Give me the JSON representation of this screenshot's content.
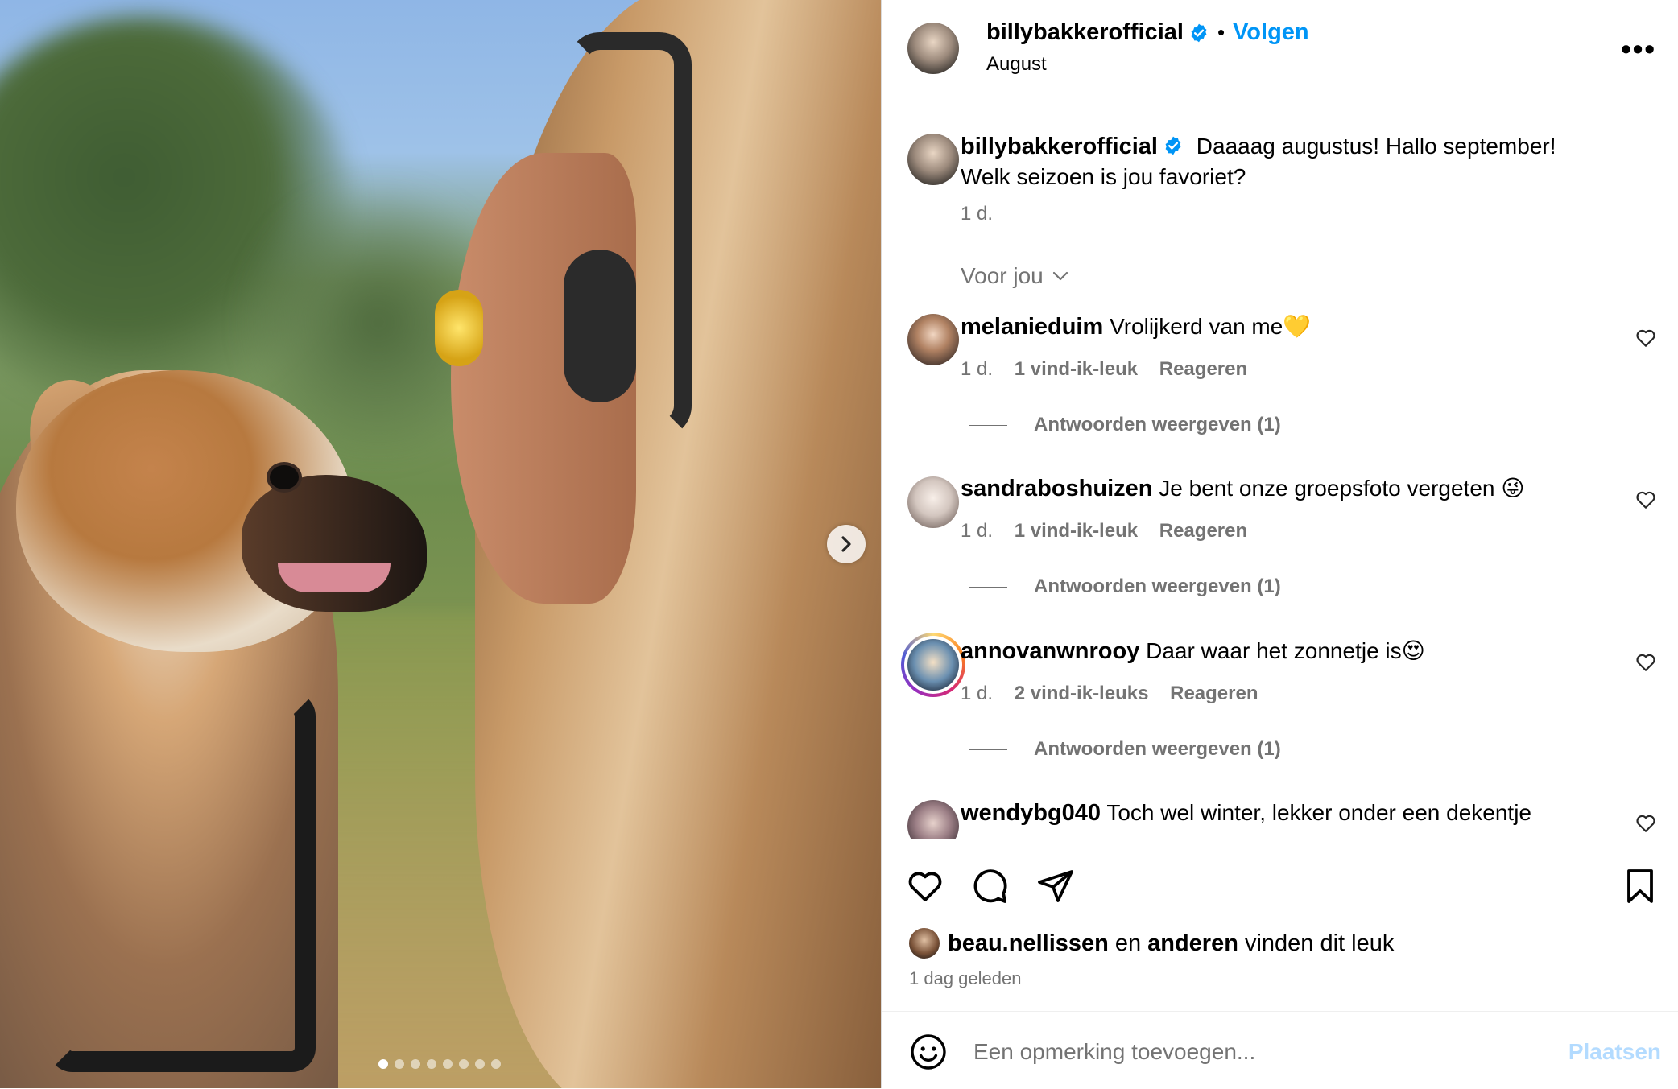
{
  "header": {
    "username": "billybakkerofficial",
    "separator": "•",
    "follow_label": "Volgen",
    "subline": "August",
    "more_label": "•••"
  },
  "caption": {
    "username": "billybakkerofficial",
    "text": "Daaaag augustus! Hallo september!",
    "text_line2": "Welk seizoen is jou favoriet?",
    "time": "1 d."
  },
  "sort": {
    "label": "Voor jou"
  },
  "comments": [
    {
      "username": "melanieduim",
      "text": "Vrolijkerd van me💛",
      "time": "1 d.",
      "likes": "1 vind-ik-leuk",
      "reply": "Reageren",
      "view_replies": "Antwoorden weergeven (1)"
    },
    {
      "username": "sandraboshuizen",
      "text": "Je bent onze groepsfoto vergeten 😜",
      "time": "1 d.",
      "likes": "1 vind-ik-leuk",
      "reply": "Reageren",
      "view_replies": "Antwoorden weergeven (1)"
    },
    {
      "username": "annovanwnrooy",
      "text": "Daar waar het zonnetje is😍",
      "time": "1 d.",
      "likes": "2 vind-ik-leuks",
      "reply": "Reageren",
      "view_replies": "Antwoorden weergeven (1)"
    },
    {
      "username": "wendybg040",
      "text": "Toch wel winter, lekker onder een dekentje"
    }
  ],
  "likes": {
    "user": "beau.nellissen",
    "conj": "en",
    "others": "anderen",
    "suffix": "vinden dit leuk",
    "time": "1 dag geleden"
  },
  "composer": {
    "placeholder": "Een opmerking toevoegen...",
    "post_label": "Plaatsen"
  },
  "carousel": {
    "slide_count": 8,
    "active_index": 0
  },
  "colors": {
    "accent": "#0095f6",
    "muted": "#737373",
    "post_disabled": "#b3dbff"
  },
  "icons": [
    "verified-badge-icon",
    "more-icon",
    "chevron-right-icon",
    "chevron-down-icon",
    "heart-icon",
    "comment-icon",
    "share-icon",
    "bookmark-icon",
    "emoji-icon"
  ]
}
